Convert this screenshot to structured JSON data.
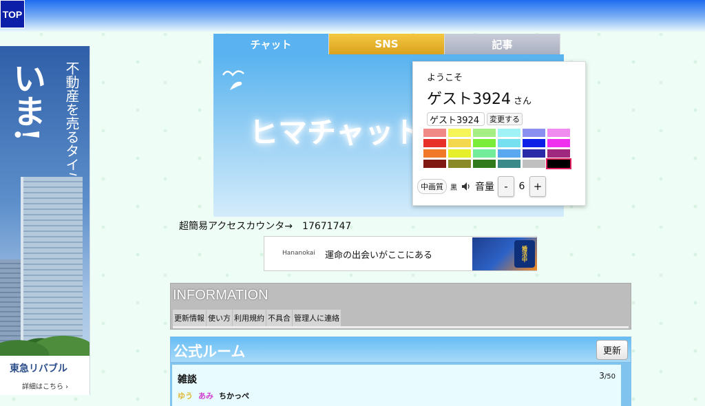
{
  "header": {
    "top_label": "TOP"
  },
  "left_ad": {
    "headline_big": "いま!",
    "headline_small": "不動産を売るタイミングは",
    "brand": "東急リバブル",
    "link": "詳細はこちら ›"
  },
  "tabs": [
    {
      "label": "チャット",
      "color": "#5ab3f0"
    },
    {
      "label": "SNS",
      "color": "#e8b630"
    },
    {
      "label": "記事",
      "color": "#b9bdcc"
    }
  ],
  "hero": {
    "title": "ヒマチャット"
  },
  "profile": {
    "welcome": "ようこそ",
    "name": "ゲスト3924",
    "suffix": "さん",
    "name_input_value": "ゲスト3924",
    "change_button": "変更する",
    "palette": [
      "#f08a86",
      "#f5f55a",
      "#a6ef84",
      "#9ff3f6",
      "#8b8ff0",
      "#f08cf0",
      "#e8302a",
      "#f2d84a",
      "#7bec3a",
      "#76e0f0",
      "#0d20e6",
      "#ef30ef",
      "#f07a2a",
      "#e6f02a",
      "#72ee9a",
      "#5aa8f0",
      "#2a2aa8",
      "#a0287f",
      "#7f1a12",
      "#8a8a28",
      "#307a1c",
      "#3a8a8a",
      "#c0c0c0",
      "#000000"
    ],
    "selected_color_index": 23,
    "quality_button": "中画質",
    "black_label": "黒",
    "volume_label": "音量",
    "volume_minus": "-",
    "volume_value": "6",
    "volume_plus": "+"
  },
  "counter": {
    "label": "超簡易アクセスカウンタ→",
    "value": "17671747"
  },
  "banner": {
    "logo": "Hananokai",
    "text": "運命の出会いがここにある",
    "badge": "婚活中"
  },
  "information": {
    "title": "INFORMATION",
    "links": [
      "更新情報",
      "使い方",
      "利用規約",
      "不具合",
      "管理人に連絡"
    ]
  },
  "official_room": {
    "title": "公式ルーム",
    "refresh_label": "更新",
    "rooms": [
      {
        "name": "雑談",
        "count": "3",
        "max": "/50",
        "members": [
          {
            "name": "ゆう",
            "color": "#e0b830"
          },
          {
            "name": "あみ",
            "color": "#d040d0"
          },
          {
            "name": "ちかっぺ",
            "color": "#111111"
          }
        ]
      }
    ]
  }
}
